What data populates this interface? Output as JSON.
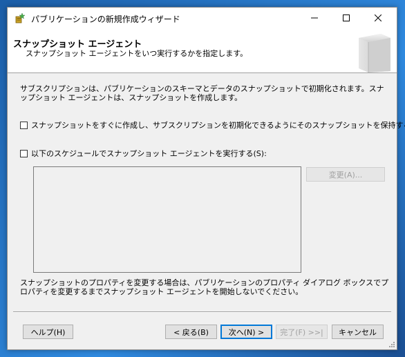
{
  "window": {
    "title": "パブリケーションの新規作成ウィザード"
  },
  "header": {
    "title": "スナップショット エージェント",
    "subtitle": "スナップショット エージェントをいつ実行するかを指定します。"
  },
  "body": {
    "intro": "サブスクリプションは、パブリケーションのスキーマとデータのスナップショットで初期化されます。スナップショット エージェントは、スナップショットを作成します。",
    "option_immediate": {
      "label": "スナップショットをすぐに作成し、サブスクリプションを初期化できるようにそのスナップショットを保持する(C)",
      "checked": false
    },
    "option_schedule": {
      "label": "以下のスケジュールでスナップショット エージェントを実行する(S):",
      "checked": false
    },
    "change_button": "変更(A)...",
    "note": "スナップショットのプロパティを変更する場合は、パブリケーションのプロパティ ダイアログ ボックスでプロパティを変更するまでスナップショット エージェントを開始しないでください。"
  },
  "footer": {
    "help": "ヘルプ(H)",
    "back": "< 戻る(B)",
    "next": "次へ(N) >",
    "finish": "完了(F) >>|",
    "cancel": "キャンセル"
  },
  "colors": {
    "accent": "#0078d7",
    "window_bg": "#f0f0f0",
    "disabled_text": "#a0a0a0"
  },
  "icons": {
    "app": "wizard-app-icon",
    "minimize": "minimize-icon",
    "maximize": "maximize-icon",
    "close": "close-icon",
    "header": "server-graphic-icon"
  }
}
